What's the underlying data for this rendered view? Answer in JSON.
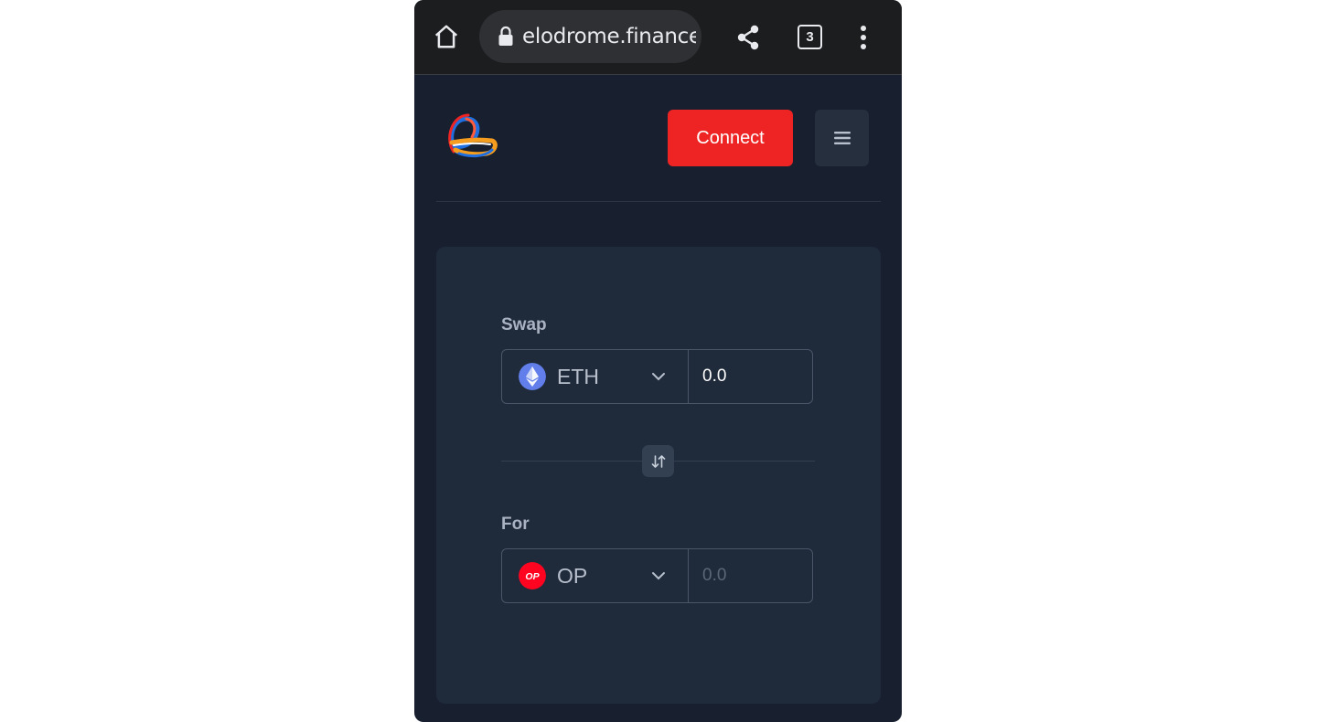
{
  "browser": {
    "url": "elodrome.finance",
    "tab_count": "3"
  },
  "header": {
    "connect_label": "Connect"
  },
  "swap": {
    "from_label": "Swap",
    "from_token": "ETH",
    "from_amount": "0.0",
    "to_label": "For",
    "to_token": "OP",
    "to_placeholder": "0.0",
    "op_badge_text": "OP"
  },
  "colors": {
    "connect_button": "#ee2424",
    "card": "#1f2a3b",
    "page": "#18202f",
    "eth_icon": "#627eea",
    "op_icon": "#ff0420"
  }
}
